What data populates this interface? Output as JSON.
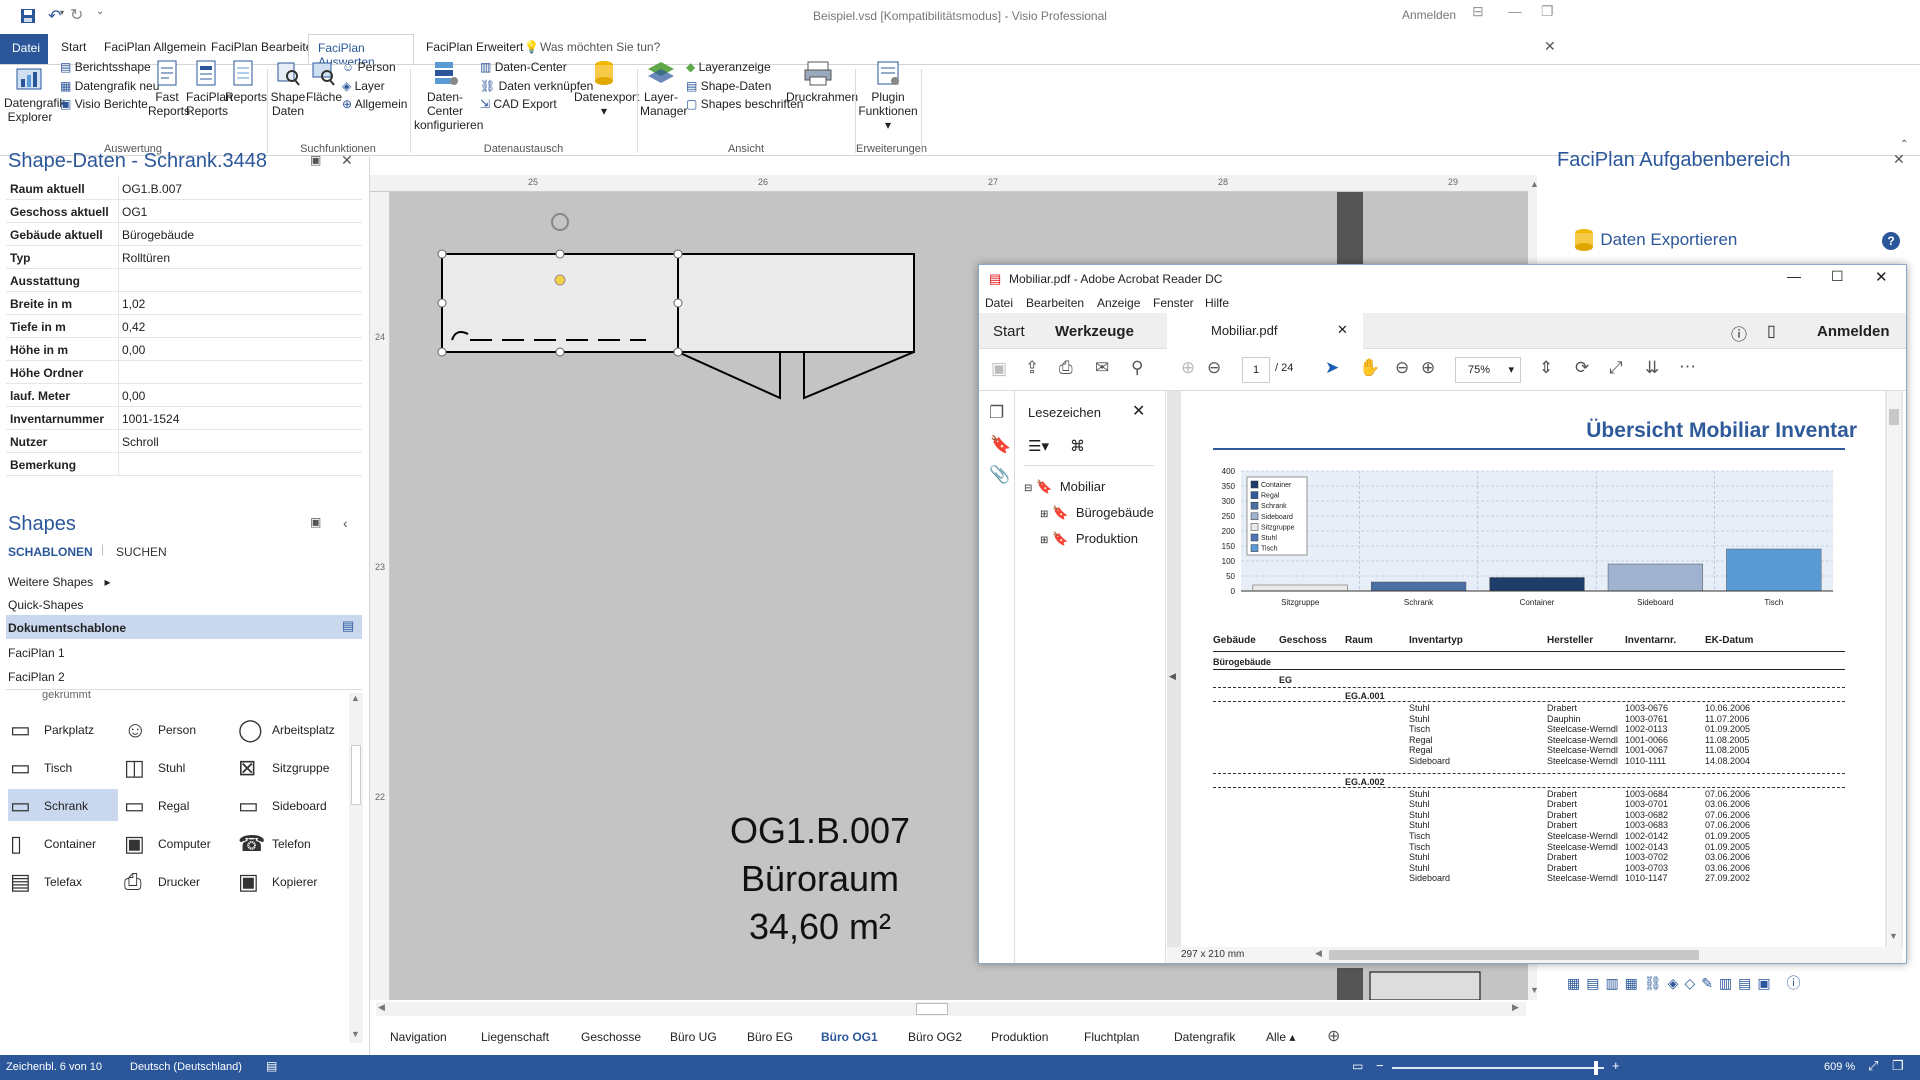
{
  "window": {
    "title": "Beispiel.vsd  [Kompatibilitätsmodus] - Visio Professional",
    "signin": "Anmelden"
  },
  "tabs": [
    "Datei",
    "Start",
    "FaciPlan Allgemein",
    "FaciPlan Bearbeiten",
    "FaciPlan Auswerten",
    "FaciPlan Erweitert"
  ],
  "tell_me": "Was möchten Sie tun?",
  "ribbon": {
    "datengrafik_explorer": "Datengrafik Explorer",
    "berichtsshape": "Berichtsshape",
    "datengrafik_neu": "Datengrafik neu",
    "visio_berichte": "Visio Berichte",
    "fast_reports": "Fast Reports",
    "faciplan_reports": "FaciPlan Reports",
    "reports": "Reports",
    "group_auswertung": "Auswertung",
    "shape_daten": "Shape Daten",
    "flaeche": "Fläche",
    "person": "Person",
    "layer": "Layer",
    "allgemein": "Allgemein",
    "group_such": "Suchfunktionen",
    "daten_center_konf": "Daten-Center konfigurieren",
    "daten_center": "Daten-Center",
    "daten_verknuepfen": "Daten verknüpfen",
    "cad_export": "CAD Export",
    "datenexport": "Datenexport",
    "group_datenaustausch": "Datenaustausch",
    "layer_manager": "Layer-Manager",
    "layeranzeige": "Layeranzeige",
    "shape_daten2": "Shape-Daten",
    "shapes_beschriften": "Shapes beschriften",
    "druckrahmen": "Druckrahmen",
    "group_ansicht": "Ansicht",
    "plugin_funktionen": "Plugin Funktionen",
    "group_erweiterungen": "Erweiterungen"
  },
  "shape_data": {
    "title": "Shape-Daten - Schrank.3448",
    "rows": [
      {
        "k": "Raum aktuell",
        "v": "OG1.B.007"
      },
      {
        "k": "Geschoss aktuell",
        "v": "OG1"
      },
      {
        "k": "Gebäude aktuell",
        "v": "Bürogebäude"
      },
      {
        "k": "Typ",
        "v": "Rolltüren"
      },
      {
        "k": "Ausstattung",
        "v": ""
      },
      {
        "k": "Breite in m",
        "v": "1,02"
      },
      {
        "k": "Tiefe in m",
        "v": "0,42"
      },
      {
        "k": "Höhe in m",
        "v": "0,00"
      },
      {
        "k": "Höhe Ordner",
        "v": ""
      },
      {
        "k": "lauf. Meter",
        "v": "0,00"
      },
      {
        "k": "Inventarnummer",
        "v": "1001-1524"
      },
      {
        "k": "Nutzer",
        "v": "Schroll"
      },
      {
        "k": "Bemerkung",
        "v": ""
      }
    ]
  },
  "shapes": {
    "title": "Shapes",
    "tab1": "SCHABLONEN",
    "tab2": "SUCHEN",
    "stencils": [
      "Weitere Shapes",
      "Quick-Shapes",
      "Dokumentschablone",
      "FaciPlan 1",
      "FaciPlan 2"
    ],
    "partial": "gekrümmt",
    "items": [
      "Parkplatz",
      "Person",
      "Arbeitsplatz",
      "Tisch",
      "Stuhl",
      "Sitzgruppe",
      "Schrank",
      "Regal",
      "Sideboard",
      "Container",
      "Computer",
      "Telefon",
      "Telefax",
      "Drucker",
      "Kopierer"
    ]
  },
  "ruler": {
    "top": [
      "25",
      "26",
      "27",
      "28",
      "29"
    ],
    "left": [
      "24",
      "23",
      "22"
    ]
  },
  "room": {
    "id": "OG1.B.007",
    "name": "Büroraum",
    "area": "34,60 m²"
  },
  "page_tabs": [
    "Navigation",
    "Liegenschaft",
    "Geschosse",
    "Büro UG",
    "Büro EG",
    "Büro OG1",
    "Büro OG2",
    "Produktion",
    "Fluchtplan",
    "Datengrafik",
    "Alle"
  ],
  "taskpane": {
    "title": "FaciPlan Aufgabenbereich",
    "action": "Daten Exportieren"
  },
  "acrobat": {
    "title": "Mobiliar.pdf - Adobe Acrobat Reader DC",
    "menu": [
      "Datei",
      "Bearbeiten",
      "Anzeige",
      "Fenster",
      "Hilfe"
    ],
    "tab_start": "Start",
    "tab_tools": "Werkzeuge",
    "doc_tab": "Mobiliar.pdf",
    "signin": "Anmelden",
    "page": "1",
    "pages": "/ 24",
    "zoom": "75%",
    "bookmarks_title": "Lesezeichen",
    "bookmarks": [
      "Mobiliar",
      "Bürogebäude",
      "Produktion"
    ],
    "doc_title": "Übersicht Mobiliar Inventar",
    "size": "297 x 210 mm",
    "table_headers": [
      "Gebäude",
      "Geschoss",
      "Raum",
      "Inventartyp",
      "Hersteller",
      "Inventarnr.",
      "EK-Datum"
    ],
    "building": "Bürogebäude",
    "floor": "EG",
    "rooms": [
      {
        "name": "EG.A.001",
        "rows": [
          [
            "Stuhl",
            "Drabert",
            "1003-0676",
            "10.06.2006"
          ],
          [
            "Stuhl",
            "Dauphin",
            "1003-0761",
            "11.07.2006"
          ],
          [
            "Tisch",
            "Steelcase-Werndl",
            "1002-0113",
            "01.09.2005"
          ],
          [
            "Regal",
            "Steelcase-Werndl",
            "1001-0066",
            "11.08.2005"
          ],
          [
            "Regal",
            "Steelcase-Werndl",
            "1001-0067",
            "11.08.2005"
          ],
          [
            "Sideboard",
            "Steelcase-Werndl",
            "1010-1111",
            "14.08.2004"
          ]
        ]
      },
      {
        "name": "EG.A.002",
        "rows": [
          [
            "Stuhl",
            "Drabert",
            "1003-0684",
            "07.06.2006"
          ],
          [
            "Stuhl",
            "Drabert",
            "1003-0701",
            "03.06.2006"
          ],
          [
            "Stuhl",
            "Drabert",
            "1003-0682",
            "07.06.2006"
          ],
          [
            "Stuhl",
            "Drabert",
            "1003-0683",
            "07.06.2006"
          ],
          [
            "Tisch",
            "Steelcase-Werndl",
            "1002-0142",
            "01.09.2005"
          ],
          [
            "Tisch",
            "Steelcase-Werndl",
            "1002-0143",
            "01.09.2005"
          ],
          [
            "Stuhl",
            "Drabert",
            "1003-0702",
            "03.06.2006"
          ],
          [
            "Stuhl",
            "Drabert",
            "1003-0703",
            "03.06.2006"
          ],
          [
            "Sideboard",
            "Steelcase-Werndl",
            "1010-1147",
            "27.09.2002"
          ]
        ]
      }
    ]
  },
  "chart_data": {
    "type": "bar",
    "categories": [
      "Sitzgruppe",
      "Schrank",
      "Container",
      "Sideboard",
      "Tisch"
    ],
    "values": [
      20,
      30,
      45,
      90,
      140
    ],
    "colors": [
      "#eaeaea",
      "#4a6fa5",
      "#1f3d6b",
      "#9fb3d0",
      "#5b9bd5"
    ],
    "ylim": [
      0,
      400
    ],
    "yticks": [
      "0",
      "50",
      "100",
      "150",
      "200",
      "250",
      "300",
      "350",
      "400"
    ],
    "legend": [
      "Container",
      "Regal",
      "Schrank",
      "Sideboard",
      "Sitzgruppe",
      "Stuhl",
      "Tisch"
    ],
    "legend_colors": [
      "#1f3d6b",
      "#2e5a9a",
      "#4a6fa5",
      "#9fb3d0",
      "#eaeaea",
      "#4f77b5",
      "#5b9bd5"
    ]
  },
  "status": {
    "page": "Zeichenbl. 6 von 10",
    "lang": "Deutsch (Deutschland)",
    "zoom": "609 %"
  }
}
